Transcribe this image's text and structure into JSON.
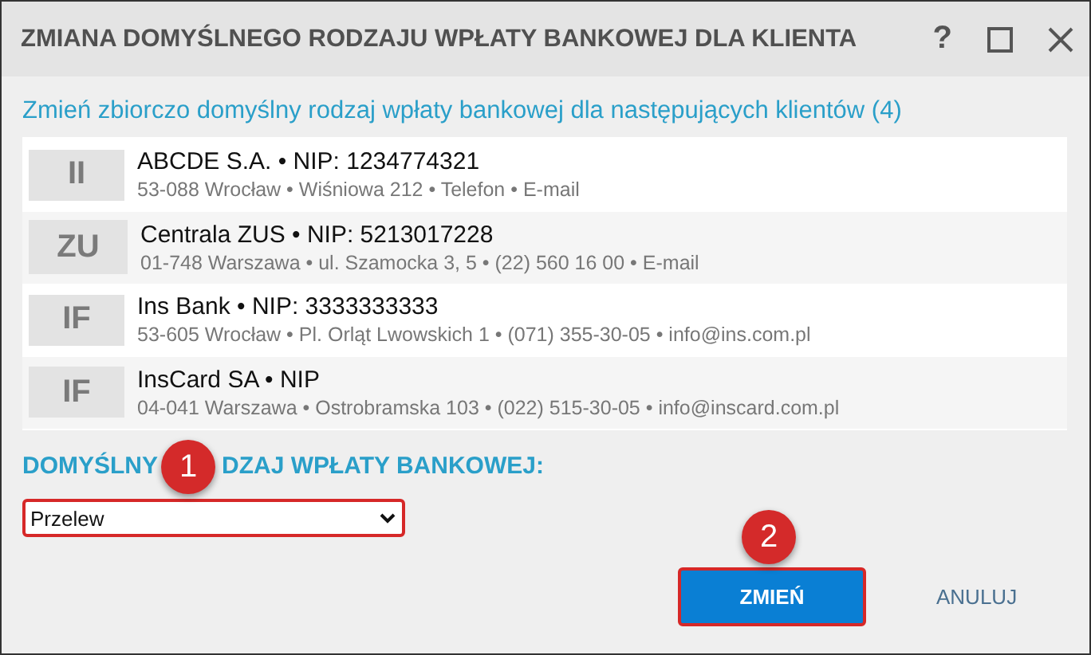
{
  "window": {
    "title": "ZMIANA DOMYŚLNEGO RODZAJU WPŁATY BANKOWEJ DLA KLIENTA",
    "help": "?"
  },
  "subtitle": "Zmień zbiorczo domyślny rodzaj wpłaty bankowej dla następujących klientów (4)",
  "clients": [
    {
      "initials": "II",
      "title": "ABCDE S.A. • NIP: 1234774321",
      "details": "53-088 Wrocław • Wiśniowa 212 • Telefon • E-mail"
    },
    {
      "initials": "ZU",
      "title": "Centrala ZUS • NIP: 5213017228",
      "details": "01-748 Warszawa • ul. Szamocka 3, 5 • (22) 560 16 00 • E-mail"
    },
    {
      "initials": "IF",
      "title": "Ins Bank • NIP: 3333333333",
      "details": "53-605 Wrocław • Pl. Orląt Lwowskich 1 • (071) 355-30-05 • info@ins.com.pl"
    },
    {
      "initials": "IF",
      "title": "InsCard SA • NIP",
      "details": "04-041 Warszawa • Ostrobramska 103 • (022) 515-30-05 • info@inscard.com.pl"
    }
  ],
  "field": {
    "label_parts": [
      "DOMYŚLNY",
      "DZAJ WPŁATY BANKOWEJ:"
    ],
    "value": "Przelew"
  },
  "buttons": [
    {
      "label": "ZMIEŃ",
      "kind": "primary"
    },
    {
      "label": "ANULUJ",
      "kind": "link"
    }
  ],
  "callouts": [
    "1",
    "2"
  ]
}
